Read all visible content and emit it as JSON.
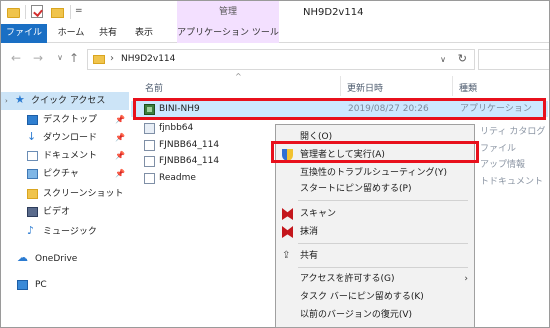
{
  "titlebar": {
    "context_tab": "管理",
    "window_title": "NH9D2v114",
    "quick_access_dropdown": "="
  },
  "ribbon": {
    "tabs": [
      {
        "label": "ファイル",
        "active": true
      },
      {
        "label": "ホーム"
      },
      {
        "label": "共有"
      },
      {
        "label": "表示"
      },
      {
        "label": "アプリケーション ツール"
      }
    ]
  },
  "nav": {
    "back": "←",
    "forward": "→",
    "recent": "∨",
    "up": "↑",
    "path_chevron": "›",
    "path": "NH9D2v114",
    "address_dropdown": "∨",
    "refresh": "↻"
  },
  "sidebar": {
    "items": [
      {
        "label": "クイック アクセス",
        "icon": "star-icon",
        "caret": "›"
      },
      {
        "label": "デスクトップ",
        "icon": "desktop-icon",
        "pinned": true
      },
      {
        "label": "ダウンロード",
        "icon": "download-icon",
        "pinned": true
      },
      {
        "label": "ドキュメント",
        "icon": "document-icon",
        "pinned": true
      },
      {
        "label": "ピクチャ",
        "icon": "pictures-icon",
        "pinned": true
      },
      {
        "label": "スクリーンショット",
        "icon": "folder-icon"
      },
      {
        "label": "ビデオ",
        "icon": "video-icon"
      },
      {
        "label": "ミュージック",
        "icon": "music-icon"
      },
      {
        "label": "OneDrive",
        "icon": "cloud-icon"
      },
      {
        "label": "PC",
        "icon": "pc-icon"
      }
    ],
    "pin_glyph": "📌"
  },
  "columns": {
    "name": "名前",
    "date": "更新日時",
    "type": "種類",
    "sort_caret": "^"
  },
  "files": [
    {
      "name": "BINI-NH9",
      "date": "2019/08/27 20:26",
      "type": "アプリケーション",
      "icon": "application-icon"
    },
    {
      "name": "fjnbb64",
      "date": "",
      "type": "",
      "icon": "config-icon"
    },
    {
      "name": "FJNBB64_114",
      "date": "",
      "type": "",
      "icon": "document-icon"
    },
    {
      "name": "FJNBB64_114",
      "date": "",
      "type": "",
      "icon": "document-icon"
    },
    {
      "name": "Readme",
      "date": "",
      "type": "",
      "icon": "document-icon"
    }
  ],
  "type_column_partial": [
    "リティ カタログ",
    "ファイル",
    "アップ情報",
    "トドキュメント"
  ],
  "context_menu": {
    "items": [
      {
        "label": "開く(O)"
      },
      {
        "label": "管理者として実行(A)",
        "icon": "admin-shield-icon"
      },
      {
        "label": "互換性のトラブルシューティング(Y)"
      },
      {
        "label": "スタートにピン留めする(P)"
      },
      {
        "label": "スキャン",
        "icon": "mcafee-icon"
      },
      {
        "label": "抹消",
        "icon": "mcafee-icon"
      },
      {
        "label": "共有",
        "icon": "share-icon"
      },
      {
        "label": "アクセスを許可する(G)",
        "submenu": true
      },
      {
        "label": "タスク バーにピン留めする(K)"
      },
      {
        "label": "以前のバージョンの復元(V)"
      }
    ],
    "submenu_arrow": "›"
  },
  "colors": {
    "highlight_box": "#e8101c",
    "file_tab": "#1a6fc4",
    "manage_tab": "#f3e0ff",
    "selection": "#cce8ff"
  }
}
